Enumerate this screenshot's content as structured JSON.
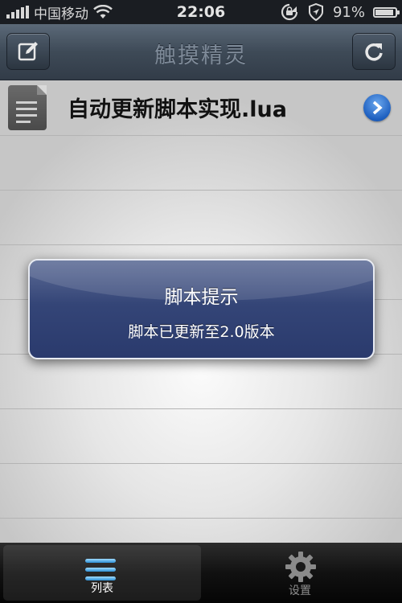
{
  "status_bar": {
    "carrier": "中国移动",
    "time": "22:06",
    "battery": "91%",
    "battery_level": 0.91,
    "icons": [
      "signal-icon",
      "wifi-icon",
      "rotation-lock-icon",
      "location-icon",
      "battery-icon"
    ]
  },
  "nav": {
    "title": "触摸精灵",
    "left_icon": "edit-icon",
    "right_icon": "refresh-icon"
  },
  "list": {
    "items": [
      {
        "name": "自动更新脚本实现.lua",
        "icon": "document-icon",
        "accessory": "disclosure-arrow-icon"
      }
    ]
  },
  "alert": {
    "title": "脚本提示",
    "message": "脚本已更新至2.0版本"
  },
  "tabbar": {
    "tabs": [
      {
        "label": "列表",
        "icon": "list-icon",
        "selected": true
      },
      {
        "label": "设置",
        "icon": "gear-icon",
        "selected": false
      }
    ]
  },
  "colors": {
    "alert_bg": "#2a3a6d",
    "nav_bg": "#3e4a57",
    "accent_blue": "#1e5fbf"
  }
}
